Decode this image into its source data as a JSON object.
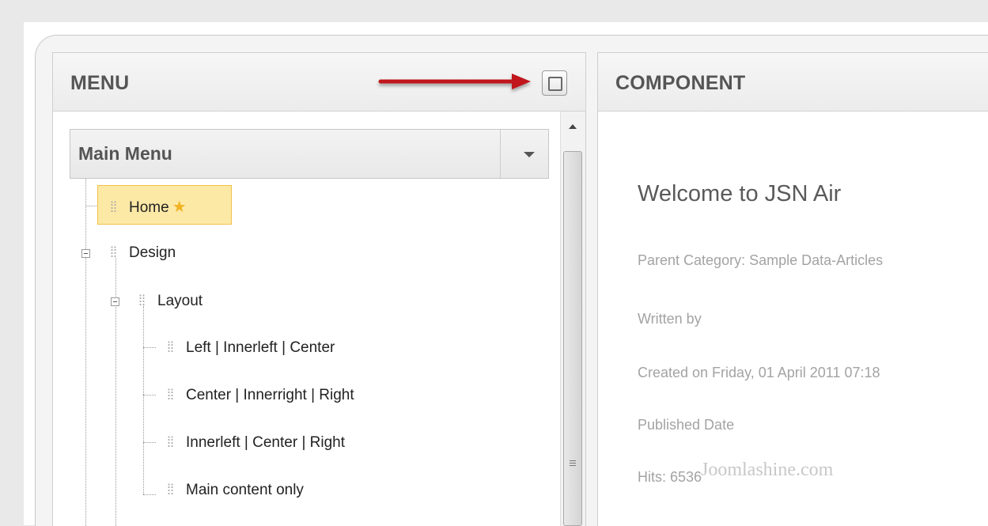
{
  "menu_panel": {
    "title": "MENU",
    "menu_select": {
      "selected": "Main Menu"
    },
    "tree": [
      {
        "label": "Home",
        "level": 0,
        "default": true,
        "highlighted": true
      },
      {
        "label": "Design",
        "level": 0,
        "expanded": true
      },
      {
        "label": "Layout",
        "level": 1,
        "expanded": true
      },
      {
        "label": "Left | Innerleft | Center",
        "level": 2
      },
      {
        "label": "Center | Innerright | Right",
        "level": 2
      },
      {
        "label": "Innerleft | Center | Right",
        "level": 2
      },
      {
        "label": "Main content only",
        "level": 2
      }
    ]
  },
  "component_panel": {
    "title": "COMPONENT",
    "article": {
      "title": "Welcome to JSN Air",
      "parent_category": "Parent Category: Sample Data-Articles",
      "written_by": "Written by",
      "created_on": "Created on Friday, 01 April 2011 07:18",
      "published_date": "Published Date",
      "hits": "Hits: 6536"
    },
    "watermark": "Joomlashine.com"
  },
  "colors": {
    "highlight": "#fde9a6",
    "highlight_border": "#f0c14b",
    "annotation_arrow": "#c0161b",
    "star": "#f0b323"
  },
  "icons": {
    "maximize": "maximize-icon",
    "dropdown": "chevron-down-icon",
    "star": "star-icon",
    "grip": "drag-handle-icon",
    "collapse": "minus-box-icon",
    "annotation": "red-arrow-icon"
  }
}
